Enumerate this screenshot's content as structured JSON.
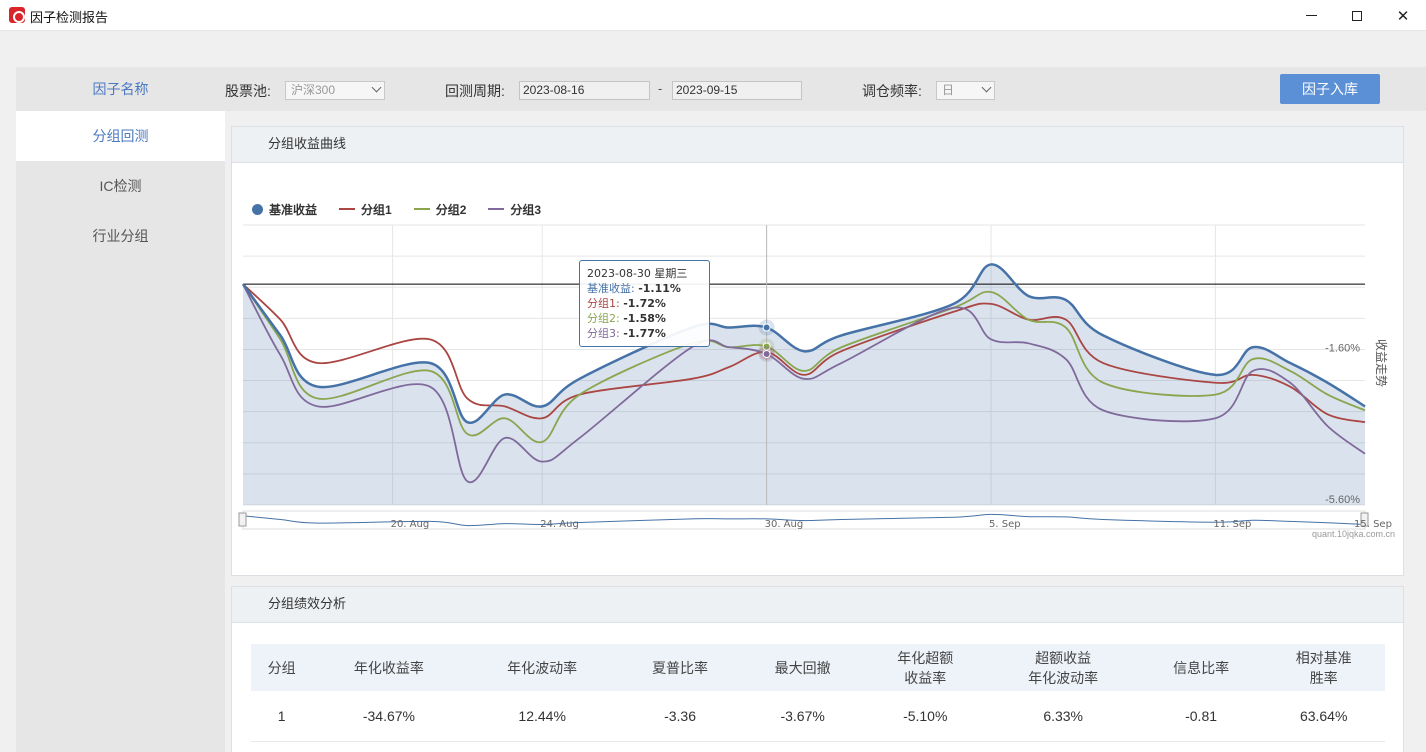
{
  "window": {
    "title": "因子检测报告"
  },
  "toolbar": {
    "stock_pool_label": "股票池:",
    "stock_pool_value": "沪深300",
    "period_label": "回测周期:",
    "start_date": "2023-08-16",
    "dash": "-",
    "end_date": "2023-09-15",
    "freq_label": "调仓频率:",
    "freq_value": "日",
    "submit_label": "因子入库"
  },
  "nav": {
    "title": "因子名称",
    "items": [
      {
        "label": "分组回测"
      },
      {
        "label": "IC检测"
      },
      {
        "label": "行业分组"
      }
    ]
  },
  "chart_panel": {
    "title": "分组收益曲线"
  },
  "perf_panel": {
    "title": "分组绩效分析"
  },
  "tooltip": {
    "date": "2023-08-30 星期三",
    "rows": [
      {
        "name": "基准收益",
        "value": "-1.11%"
      },
      {
        "name": "分组1",
        "value": "-1.72%"
      },
      {
        "name": "分组2",
        "value": "-1.58%"
      },
      {
        "name": "分组3",
        "value": "-1.77%"
      }
    ]
  },
  "watermark": "quant.10jqka.com.cn",
  "chart_data": {
    "type": "line",
    "y_axis_title": "收益走势",
    "y_ticks": [
      "-1.60%",
      "-5.60%"
    ],
    "x_ticks": [
      "20. Aug",
      "24. Aug",
      "30. Aug",
      "5. Sep",
      "11. Sep",
      "15. Sep"
    ],
    "ylim": [
      -5.6,
      1.5
    ],
    "legend_position": "top-left",
    "x": [
      "2023-08-16",
      "2023-08-17",
      "2023-08-18",
      "2023-08-21",
      "2023-08-22",
      "2023-08-23",
      "2023-08-24",
      "2023-08-25",
      "2023-08-28",
      "2023-08-29",
      "2023-08-30",
      "2023-08-31",
      "2023-09-01",
      "2023-09-04",
      "2023-09-05",
      "2023-09-06",
      "2023-09-07",
      "2023-09-08",
      "2023-09-11",
      "2023-09-12",
      "2023-09-13",
      "2023-09-14",
      "2023-09-15"
    ],
    "series": [
      {
        "name": "基准收益",
        "color": "#4572a7",
        "area": true,
        "values": [
          0.0,
          -1.3,
          -2.6,
          -2.0,
          -3.5,
          -2.8,
          -3.1,
          -2.4,
          -1.1,
          -1.1,
          -1.1,
          -1.7,
          -1.3,
          -0.5,
          0.5,
          -0.3,
          -0.4,
          -1.3,
          -2.3,
          -1.6,
          -2.0,
          -2.5,
          -3.1
        ]
      },
      {
        "name": "分组1",
        "color": "#aa4643",
        "values": [
          0.0,
          -0.9,
          -2.0,
          -1.4,
          -2.9,
          -3.1,
          -3.4,
          -2.8,
          -2.4,
          -2.1,
          -1.72,
          -2.3,
          -1.7,
          -0.7,
          -0.5,
          -0.9,
          -0.9,
          -2.0,
          -2.5,
          -2.3,
          -2.6,
          -3.3,
          -3.5
        ]
      },
      {
        "name": "分组2",
        "color": "#89a54e",
        "values": [
          0.0,
          -1.4,
          -2.9,
          -2.2,
          -3.8,
          -3.4,
          -4.0,
          -2.8,
          -1.5,
          -1.6,
          -1.58,
          -2.2,
          -1.6,
          -0.6,
          -0.2,
          -0.9,
          -1.1,
          -2.5,
          -2.8,
          -1.9,
          -2.2,
          -2.8,
          -3.2
        ]
      },
      {
        "name": "分组3",
        "color": "#80699b",
        "values": [
          0.0,
          -1.8,
          -3.1,
          -2.6,
          -5.0,
          -3.9,
          -4.5,
          -3.9,
          -1.6,
          -1.6,
          -1.77,
          -2.4,
          -2.0,
          -0.6,
          -1.4,
          -1.5,
          -1.9,
          -3.2,
          -3.4,
          -2.2,
          -2.5,
          -3.6,
          -4.3
        ]
      }
    ]
  },
  "perf_table": {
    "headers": [
      "分组",
      "年化收益率",
      "年化波动率",
      "夏普比率",
      "最大回撤",
      "年化超额\n收益率",
      "超额收益\n年化波动率",
      "信息比率",
      "相对基准\n胜率"
    ],
    "rows": [
      [
        "1",
        "-34.67%",
        "12.44%",
        "-3.36",
        "-3.67%",
        "-5.10%",
        "6.33%",
        "-0.81",
        "63.64%"
      ]
    ]
  }
}
